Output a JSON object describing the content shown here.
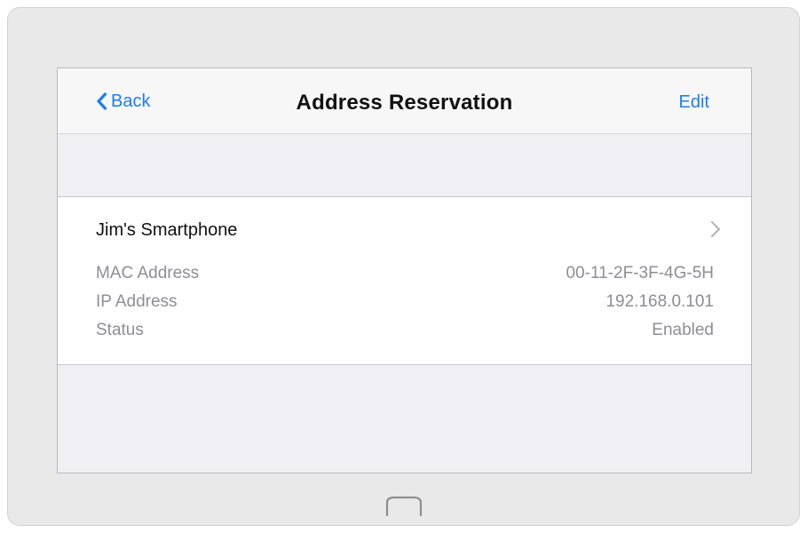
{
  "navbar": {
    "back_label": "Back",
    "title": "Address Reservation",
    "edit_label": "Edit"
  },
  "reservation": {
    "device_name": "Jim's Smartphone",
    "rows": [
      {
        "label": "MAC Address",
        "value": "00-11-2F-3F-4G-5H"
      },
      {
        "label": "IP Address",
        "value": "192.168.0.101"
      },
      {
        "label": "Status",
        "value": "Enabled"
      }
    ]
  },
  "icons": {
    "back": "chevron-left-icon",
    "disclosure": "chevron-right-icon",
    "home": "home-button-icon"
  },
  "colors": {
    "accent": "#1a7ff5",
    "secondary_text": "#8e8e93",
    "background": "#efeff4"
  }
}
